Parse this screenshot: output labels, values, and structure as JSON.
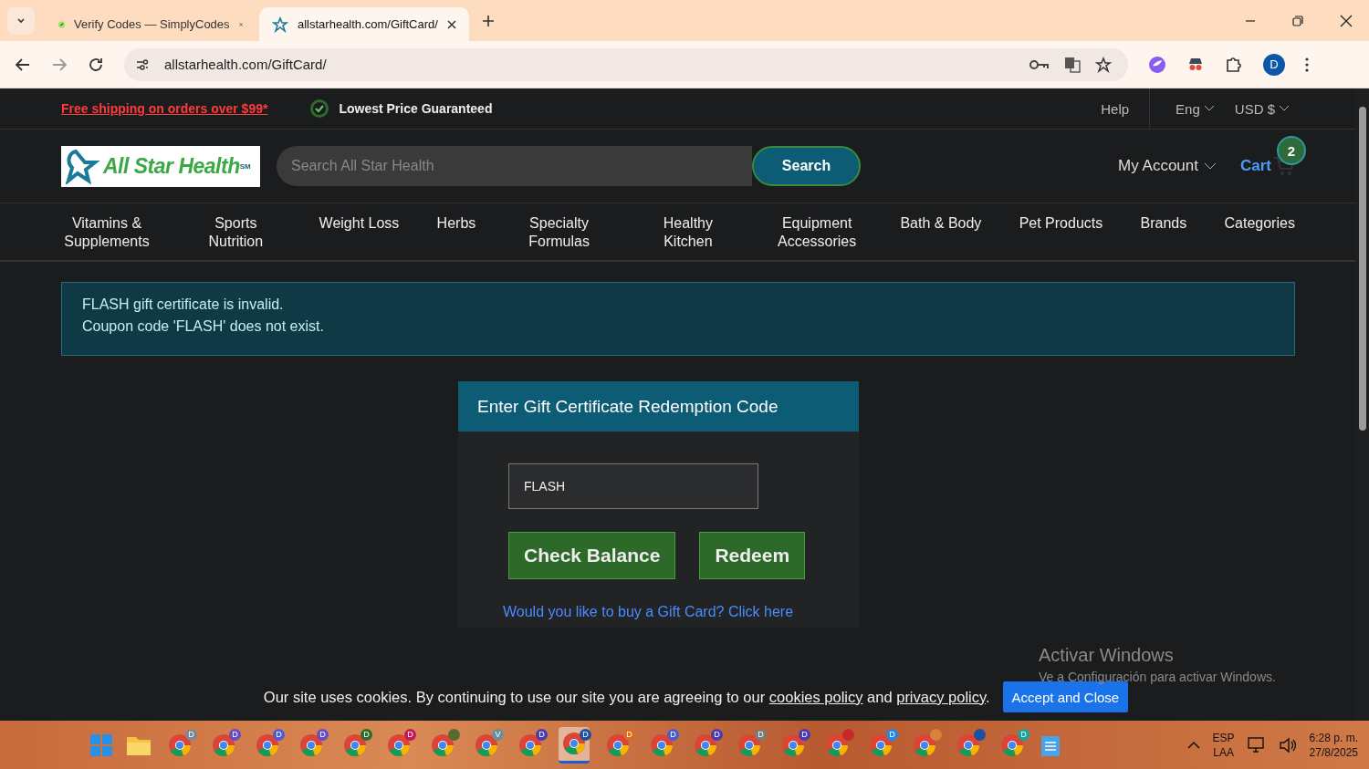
{
  "browser": {
    "tabs": [
      {
        "title": "Verify Codes — SimplyCodes",
        "selected": false
      },
      {
        "title": "allstarhealth.com/GiftCard/",
        "selected": true
      }
    ],
    "address": "allstarhealth.com/GiftCard/",
    "profile_initial": "D"
  },
  "topbar": {
    "promo": "Free shipping on orders over $99*",
    "guarantee": "Lowest Price Guaranteed",
    "help": "Help",
    "language": "Eng",
    "currency": "USD $"
  },
  "header": {
    "logo_text": "All Star Health",
    "logo_mark": "SM",
    "search": {
      "placeholder": "Search All Star Health",
      "button": "Search"
    },
    "account": "My Account",
    "cart": "Cart",
    "cart_count": "2"
  },
  "nav": [
    {
      "label": "Vitamins & Supplements"
    },
    {
      "label": "Sports Nutrition"
    },
    {
      "label": "Weight Loss"
    },
    {
      "label": "Herbs"
    },
    {
      "label": "Specialty Formulas"
    },
    {
      "label": "Healthy Kitchen"
    },
    {
      "label": "Equipment Accessories"
    },
    {
      "label": "Bath & Body"
    },
    {
      "label": "Pet Products"
    },
    {
      "label": "Brands"
    },
    {
      "label": "Categories"
    }
  ],
  "alert": [
    "FLASH gift certificate is invalid.",
    "Coupon code 'FLASH' does not exist."
  ],
  "gift_panel": {
    "title": "Enter Gift Certificate Redemption Code",
    "code_value": "FLASH",
    "buttons": [
      "Check Balance",
      "Redeem"
    ],
    "link": "Would you like to buy a Gift Card? Click here"
  },
  "cookie": {
    "text_before": "Our site uses cookies. By continuing to use our site you are agreeing to our",
    "cookies_link": "cookies policy",
    "and": "and",
    "privacy_link": "privacy policy",
    "period": ".",
    "button": "Accept and Close"
  },
  "windows_notice": {
    "title": "Activar Windows",
    "text": "Ve a Configuración para activar Windows."
  },
  "taskbar": {
    "apps": [
      {
        "badge": "D",
        "color": "#7b8794",
        "active": false
      },
      {
        "badge": "D",
        "color": "#6a4bc4",
        "active": false
      },
      {
        "badge": "D",
        "color": "#4e5bd0",
        "active": false
      },
      {
        "badge": "D",
        "color": "#6a4bc4",
        "active": false
      },
      {
        "badge": "D",
        "color": "#2f6b2a",
        "active": false
      },
      {
        "badge": "D",
        "color": "#c2185b",
        "active": false
      },
      {
        "color": "#556b2f",
        "active": false
      },
      {
        "badge": "V",
        "color": "#6b8e9b",
        "active": false
      },
      {
        "badge": "D",
        "color": "#4b3bb0",
        "active": false
      },
      {
        "badge": "D",
        "color": "#1f4fa0",
        "active": true
      },
      {
        "badge": "D",
        "color": "#e06a1b",
        "active": false
      },
      {
        "badge": "D",
        "color": "#4e5bd0",
        "active": false
      },
      {
        "badge": "D",
        "color": "#4b3bb0",
        "active": false
      },
      {
        "badge": "D",
        "color": "#7a7a7a",
        "active": false
      },
      {
        "badge": "D",
        "color": "#4b3bb0",
        "active": false
      },
      {
        "color": "#c62828",
        "active": false
      },
      {
        "badge": "D",
        "color": "#1e88e5",
        "active": false
      },
      {
        "color": "#d9823b",
        "active": false
      },
      {
        "color": "#1f4fa0",
        "active": false
      },
      {
        "badge": "D",
        "color": "#1aa39a",
        "active": false
      }
    ],
    "lang": "ESP",
    "layout": "LAA",
    "time": "6:28 p. m.",
    "date": "27/8/2025"
  }
}
